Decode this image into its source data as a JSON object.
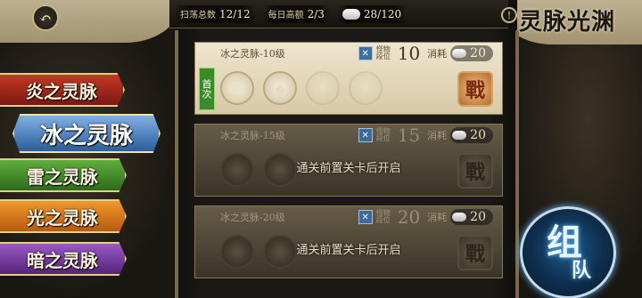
{
  "header": {
    "back_icon": "back-arrow-icon",
    "stats": [
      {
        "label": "扫荡总数",
        "value": "12/12"
      },
      {
        "label": "每日高额",
        "value": "2/3"
      },
      {
        "label": "",
        "value": "28/120"
      }
    ],
    "title": "灵脉光渊"
  },
  "tabs": [
    {
      "label": "炎之灵脉"
    },
    {
      "label": "冰之灵脉"
    },
    {
      "label": "雷之灵脉"
    },
    {
      "label": "光之灵脉"
    },
    {
      "label": "暗之灵脉"
    }
  ],
  "cards": [
    {
      "name": "冰之灵脉-10级",
      "rec_label": "怪物段位",
      "rec_value": "10",
      "cost_label": "消耗",
      "cost_value": "20",
      "first_label": "首次",
      "battle_label": "戰",
      "locked_message": ""
    },
    {
      "name": "冰之灵脉-15级",
      "rec_label": "怪物段位",
      "rec_value": "15",
      "cost_label": "消耗",
      "cost_value": "20",
      "battle_label": "戰",
      "locked_message": "通关前置关卡后开启"
    },
    {
      "name": "冰之灵脉-20级",
      "rec_label": "怪物段位",
      "rec_value": "20",
      "cost_label": "消耗",
      "cost_value": "20",
      "battle_label": "戰",
      "locked_message": "通关前置关卡后开启"
    }
  ],
  "team_button": {
    "line1": "组",
    "line2": "队"
  },
  "colors": {
    "fire": "#c43a22",
    "ice": "#4f86c6",
    "thunder": "#4e9a30",
    "light": "#e0861f",
    "dark": "#7d40a8"
  }
}
